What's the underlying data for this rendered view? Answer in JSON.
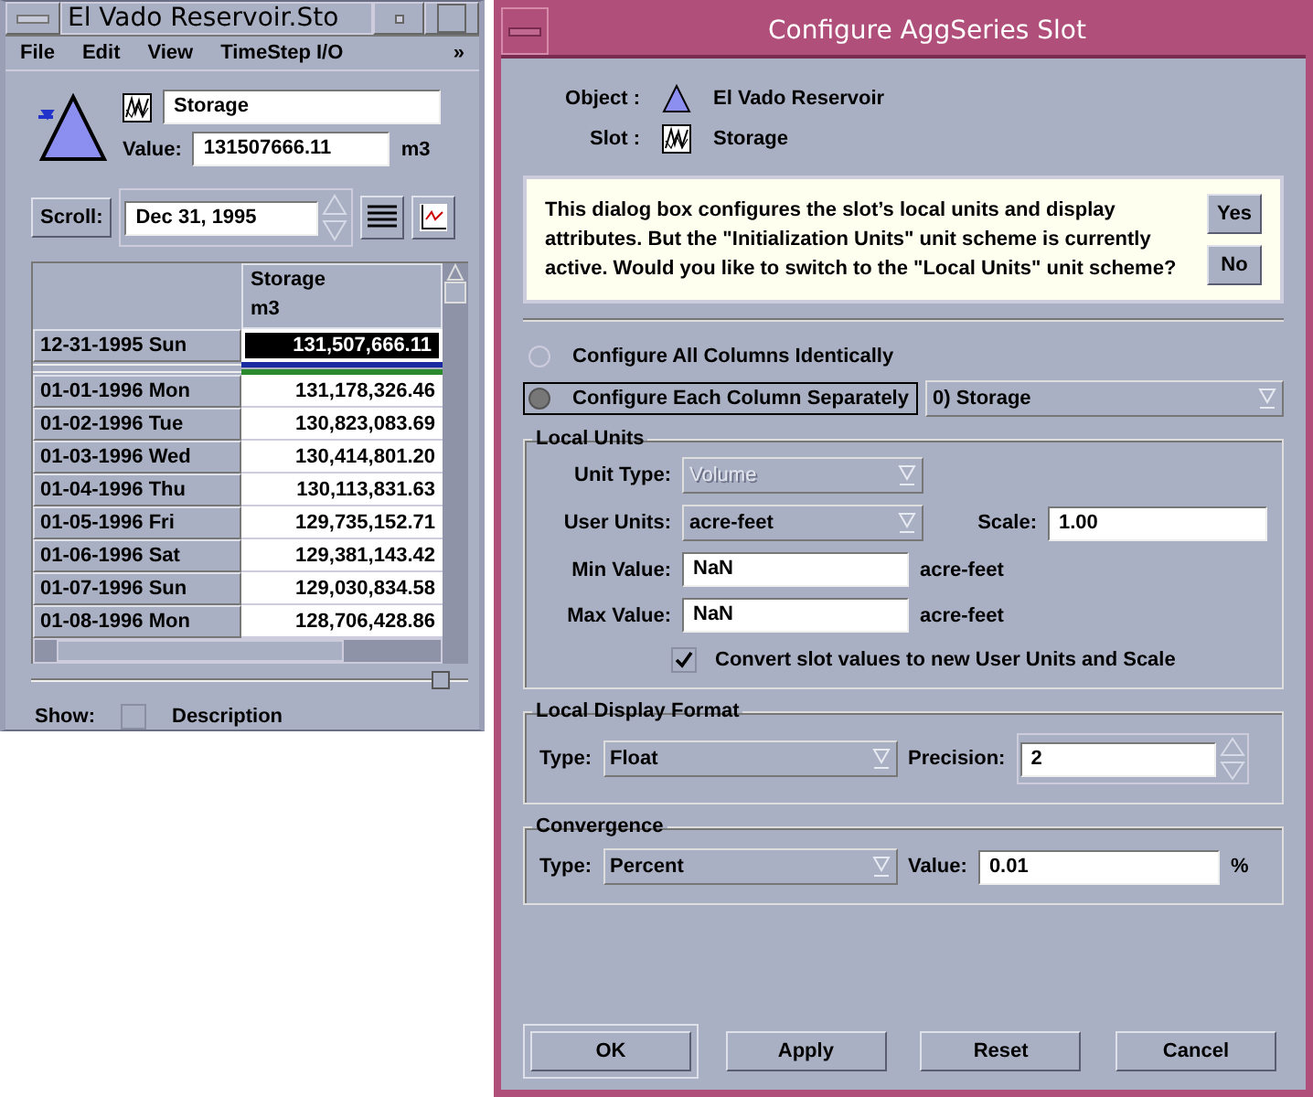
{
  "slot_window": {
    "title": "El Vado Reservoir.Sto",
    "menu": [
      {
        "label": "File"
      },
      {
        "label": "Edit"
      },
      {
        "label": "View"
      },
      {
        "label": "TimeStep I/O"
      },
      {
        "label": "»"
      }
    ],
    "slot_name": "Storage",
    "value_label": "Value:",
    "value": "131507666.11",
    "value_unit": "m3",
    "scroll_label": "Scroll:",
    "scroll_date": "Dec 31, 1995",
    "table": {
      "column_name": "Storage",
      "column_unit": "m3",
      "rows": [
        {
          "date": "12-31-1995 Sun",
          "value": "131,507,666.11",
          "selected": true
        },
        {
          "date": "01-01-1996 Mon",
          "value": "131,178,326.46",
          "selected": false
        },
        {
          "date": "01-02-1996 Tue",
          "value": "130,823,083.69",
          "selected": false
        },
        {
          "date": "01-03-1996 Wed",
          "value": "130,414,801.20",
          "selected": false
        },
        {
          "date": "01-04-1996 Thu",
          "value": "130,113,831.63",
          "selected": false
        },
        {
          "date": "01-05-1996 Fri",
          "value": "129,735,152.71",
          "selected": false
        },
        {
          "date": "01-06-1996 Sat",
          "value": "129,381,143.42",
          "selected": false
        },
        {
          "date": "01-07-1996 Sun",
          "value": "129,030,834.58",
          "selected": false
        },
        {
          "date": "01-08-1996 Mon",
          "value": "128,706,428.86",
          "selected": false
        }
      ]
    },
    "show_label": "Show:",
    "description": {
      "label": "Description",
      "checked": false
    }
  },
  "dialog": {
    "title": "Configure AggSeries Slot",
    "object_label": "Object :",
    "object_name": "El Vado Reservoir",
    "slot_label": "Slot :",
    "slot_name": "Storage",
    "message": "This dialog box configures the slot’s local units and display attributes. But the \"Initialization Units\" unit scheme is currently active. Would you like to switch to the \"Local Units\" unit scheme?",
    "message_buttons": [
      "Yes",
      "No"
    ],
    "modes": [
      {
        "label": "Configure All Columns Identically",
        "selected": false
      },
      {
        "label": "Configure Each Column Separately",
        "selected": true
      }
    ],
    "column_choice": "0)  Storage",
    "local_units": {
      "title": "Local Units",
      "unit_type": {
        "label": "Unit Type:",
        "value": "Volume",
        "disabled": true
      },
      "user_units": {
        "label": "User Units:",
        "value": "acre-feet",
        "disabled": false
      },
      "scale": {
        "label": "Scale:",
        "value": "1.00"
      },
      "min": {
        "label": "Min Value:",
        "value": "NaN",
        "unit": "acre-feet"
      },
      "max": {
        "label": "Max Value:",
        "value": "NaN",
        "unit": "acre-feet"
      },
      "convert": {
        "label": "Convert slot values to new User Units and Scale",
        "checked": true
      }
    },
    "display_format": {
      "title": "Local Display Format",
      "type_label": "Type:",
      "type": "Float",
      "precision_label": "Precision:",
      "precision": "2"
    },
    "convergence": {
      "title": "Convergence",
      "type_label": "Type:",
      "type": "Percent",
      "value_label": "Value:",
      "value": "0.01",
      "unit": "%"
    },
    "buttons": [
      "OK",
      "Apply",
      "Reset",
      "Cancel"
    ]
  }
}
